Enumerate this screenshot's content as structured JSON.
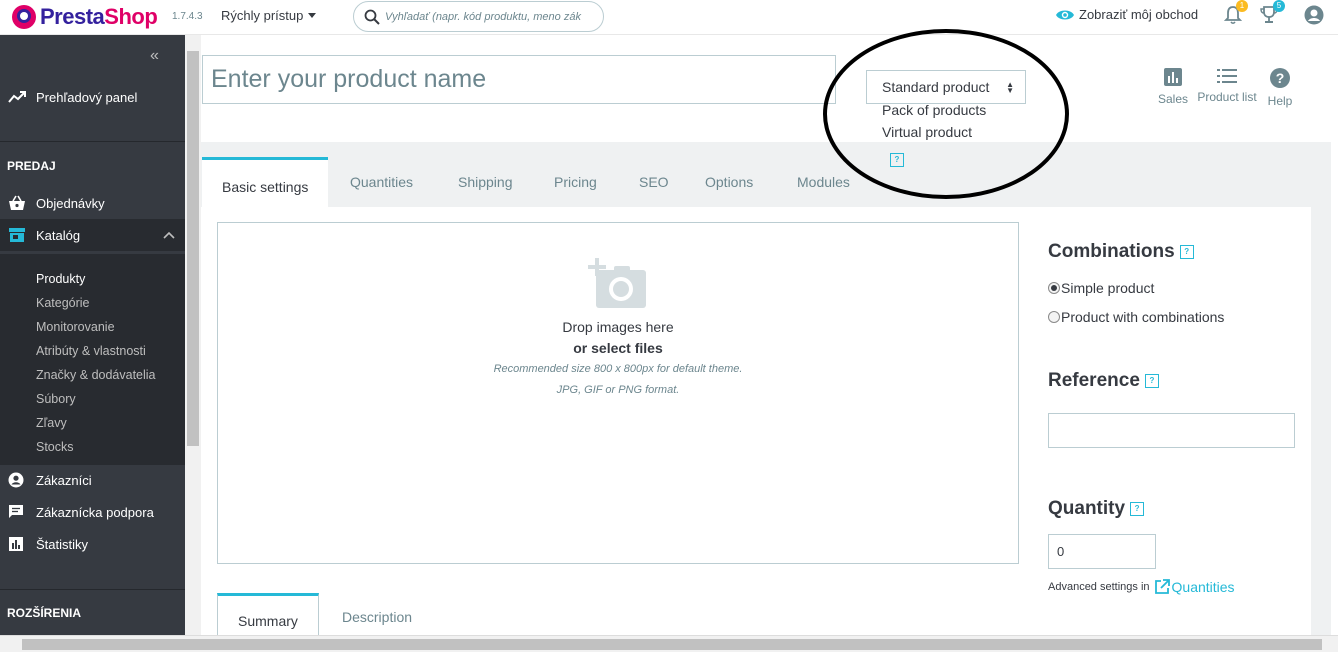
{
  "header": {
    "brand_part1": "Presta",
    "brand_part2": "Shop",
    "version": "1.7.4.3",
    "quick_access": "Rýchly prístup",
    "search_placeholder": "Vyhľadať (napr. kód produktu, meno zák",
    "view_shop": "Zobraziť môj obchod",
    "notifications_count": "1",
    "trophy_count": "5"
  },
  "sidebar": {
    "collapse_glyph": "«",
    "dashboard": "Prehľadový panel",
    "section_sell": "PREDAJ",
    "orders": "Objednávky",
    "catalog": "Katalóg",
    "catalog_items": [
      "Produkty",
      "Kategórie",
      "Monitorovanie",
      "Atribúty & vlastnosti",
      "Značky & dodávatelia",
      "Súbory",
      "Zľavy",
      "Stocks"
    ],
    "customers": "Zákazníci",
    "support": "Zákaznícka podpora",
    "stats": "Štatistiky",
    "section_extend": "ROZŠÍRENIA"
  },
  "product": {
    "name_placeholder": "Enter your product name",
    "type_selected": "Standard product",
    "type_options": [
      "Standard product",
      "Pack of products",
      "Virtual product"
    ],
    "help_glyph": "?"
  },
  "toolbar": {
    "sales": "Sales",
    "product_list": "Product list",
    "help": "Help"
  },
  "tabs": [
    "Basic settings",
    "Quantities",
    "Shipping",
    "Pricing",
    "SEO",
    "Options",
    "Modules"
  ],
  "dropzone": {
    "drop_text": "Drop images here",
    "select_files": "or select files",
    "recommended_size": "Recommended size 800 x 800px for default theme.",
    "format": "JPG, GIF or PNG format."
  },
  "sub_tabs": [
    "Summary",
    "Description"
  ],
  "right_column": {
    "combinations_title": "Combinations",
    "simple_product": "Simple product",
    "with_combinations": "Product with combinations",
    "reference_title": "Reference",
    "reference_value": "",
    "quantity_title": "Quantity",
    "quantity_value": "0",
    "advanced_settings": "Advanced settings in",
    "quantities_link": "Quantities"
  },
  "colors": {
    "accent": "#25b9d7",
    "sidebar_bg": "#363a41",
    "brand_pink": "#df0067",
    "brand_blue": "#34219e"
  }
}
